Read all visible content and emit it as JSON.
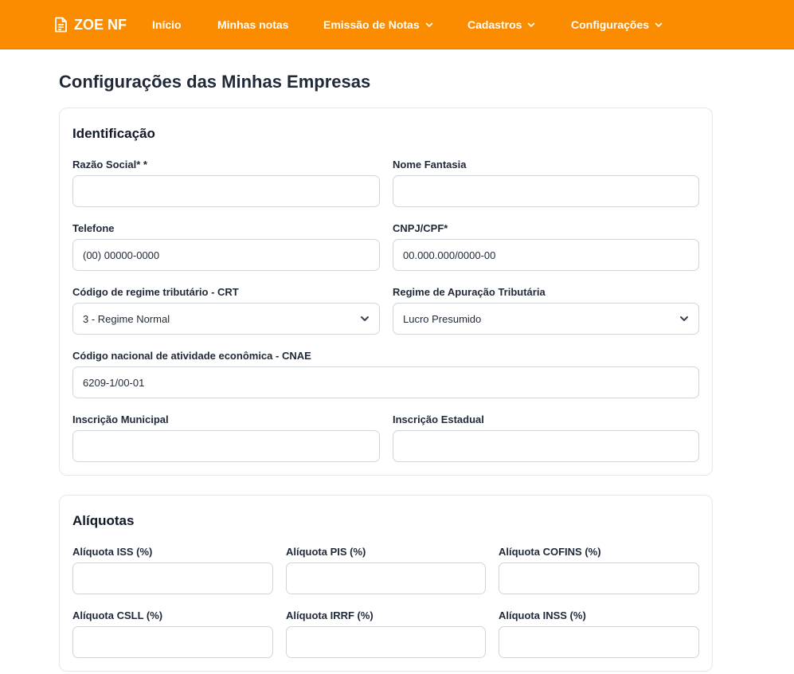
{
  "nav": {
    "brand": "ZOE NF",
    "items": [
      {
        "label": "Início",
        "dropdown": false
      },
      {
        "label": "Minhas notas",
        "dropdown": false
      },
      {
        "label": "Emissão de Notas",
        "dropdown": true
      },
      {
        "label": "Cadastros",
        "dropdown": true
      },
      {
        "label": "Configurações",
        "dropdown": true
      }
    ],
    "color": "#fb8c00"
  },
  "page_title": "Configurações das Minhas Empresas",
  "identificacao": {
    "title": "Identificação",
    "razao_social": {
      "label": "Razão Social* *",
      "value": "",
      "placeholder": ""
    },
    "nome_fantasia": {
      "label": "Nome Fantasia",
      "value": "",
      "placeholder": ""
    },
    "telefone": {
      "label": "Telefone",
      "value": "",
      "placeholder": "(00) 00000-0000"
    },
    "cnpj_cpf": {
      "label": "CNPJ/CPF*",
      "value": "",
      "placeholder": "00.000.000/0000-00"
    },
    "crt": {
      "label": "Código de regime tributário - CRT",
      "selected": "3 - Regime Normal"
    },
    "regime_apuracao": {
      "label": "Regime de Apuração Tributária",
      "selected": "Lucro Presumido"
    },
    "cnae": {
      "label": "Código nacional de atividade econômica - CNAE",
      "value": "",
      "placeholder": "6209-1/00-01"
    },
    "inscricao_municipal": {
      "label": "Inscrição Municipal",
      "value": "",
      "placeholder": ""
    },
    "inscricao_estadual": {
      "label": "Inscrição Estadual",
      "value": "",
      "placeholder": ""
    }
  },
  "aliquotas": {
    "title": "Alíquotas",
    "iss": {
      "label": "Alíquota ISS (%)",
      "value": ""
    },
    "pis": {
      "label": "Alíquota PIS (%)",
      "value": ""
    },
    "cofins": {
      "label": "Alíquota COFINS (%)",
      "value": ""
    },
    "csll": {
      "label": "Alíquota CSLL (%)",
      "value": ""
    },
    "irrf": {
      "label": "Alíquota IRRF (%)",
      "value": ""
    },
    "inss": {
      "label": "Alíquota INSS (%)",
      "value": ""
    }
  }
}
